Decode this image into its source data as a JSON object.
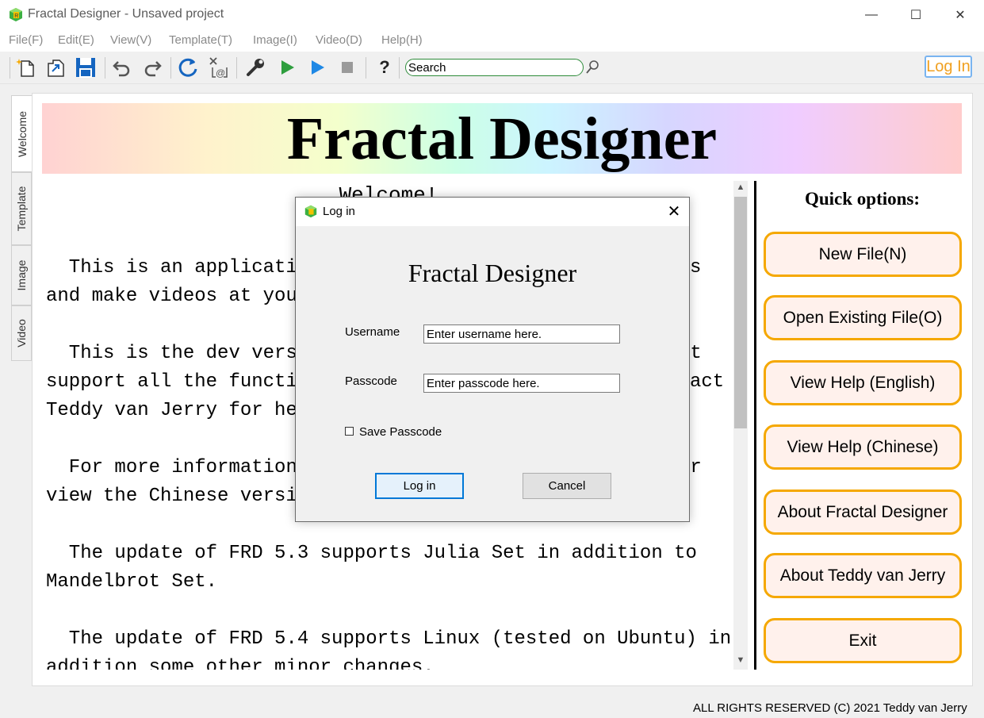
{
  "window": {
    "title": "Fractal Designer - Unsaved project",
    "minimize": "—",
    "maximize": "☐",
    "close": "✕"
  },
  "menu": [
    "File(F)",
    "Edit(E)",
    "View(V)",
    "Template(T)",
    "Image(I)",
    "Video(D)",
    "Help(H)"
  ],
  "toolbar": {
    "icons": [
      "new-file-icon",
      "export-icon",
      "save-icon",
      "undo-icon",
      "redo-icon",
      "refresh-icon",
      "clear-icon",
      "settings-wrench-icon",
      "play-green-icon",
      "play-blue-icon",
      "stop-icon",
      "help-icon"
    ],
    "help_glyph": "?",
    "search_value": "Search",
    "login_label": "Log In"
  },
  "tabs": [
    "Welcome",
    "Template",
    "Image",
    "Video"
  ],
  "banner": {
    "title": "Fractal Designer"
  },
  "welcome_text": {
    "heading": "Welcome!",
    "lines": [
      "  This is an applicati",
      "and make videos at you",
      "",
      "  This is the dev vers",
      "support all the functi",
      "Teddy van Jerry for he",
      "",
      "  For more information",
      "view the Chinese versi",
      "",
      "  The update of FRD 5.3 supports Julia Set in addition to",
      "Mandelbrot Set.",
      "",
      "  The update of FRD 5.4 supports Linux (tested on Ubuntu) in",
      "addition some other minor changes."
    ],
    "right_fragments": {
      "line1": "s",
      "line4": "ot",
      "line5": "act",
      "line8": "or"
    }
  },
  "quick_options": {
    "title": "Quick options:",
    "buttons": [
      "New File(N)",
      "Open Existing File(O)",
      "View Help (English)",
      "View Help (Chinese)",
      "About Fractal Designer",
      "About Teddy van Jerry",
      "Exit"
    ]
  },
  "footer": "ALL RIGHTS RESERVED (C) 2021 Teddy van Jerry",
  "dialog": {
    "title": "Log in",
    "close": "✕",
    "heading": "Fractal Designer",
    "username_label": "Username",
    "username_placeholder": "Enter username here.",
    "passcode_label": "Passcode",
    "passcode_placeholder": "Enter passcode here.",
    "save_passcode": "Save Passcode",
    "login_button": "Log in",
    "cancel_button": "Cancel"
  },
  "colors": {
    "accent_orange": "#f5a800",
    "quick_btn_bg": "#fff1ec",
    "login_text": "#f0a020",
    "search_border": "#2e8b3a",
    "dialog_focus": "#0078d7"
  }
}
